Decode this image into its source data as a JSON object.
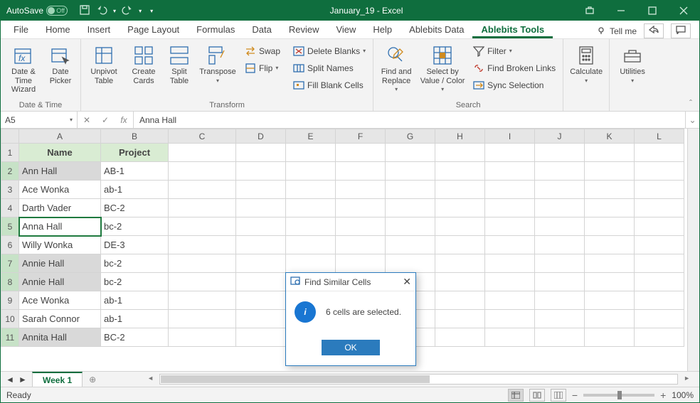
{
  "titlebar": {
    "autosave": "AutoSave",
    "autosave_state": "Off",
    "title": "January_19  -  Excel"
  },
  "tabs": {
    "items": [
      "File",
      "Home",
      "Insert",
      "Page Layout",
      "Formulas",
      "Data",
      "Review",
      "View",
      "Help",
      "Ablebits Data",
      "Ablebits Tools"
    ],
    "tellme": "Tell me"
  },
  "ribbon": {
    "datetime": {
      "label": "Date & Time",
      "date_time_wizard": "Date &\nTime Wizard",
      "date_picker": "Date\nPicker"
    },
    "transform": {
      "label": "Transform",
      "unpivot": "Unpivot\nTable",
      "create_cards": "Create\nCards",
      "split_table": "Split\nTable",
      "transpose": "Transpose",
      "swap": "Swap",
      "flip": "Flip",
      "delete_blanks": "Delete Blanks",
      "split_names": "Split Names",
      "fill_blank": "Fill Blank Cells"
    },
    "search": {
      "label": "Search",
      "find_replace": "Find and\nReplace",
      "select_by": "Select by\nValue / Color",
      "filter": "Filter",
      "broken": "Find Broken Links",
      "sync": "Sync Selection"
    },
    "calculate": {
      "label": "",
      "btn": "Calculate"
    },
    "utilities": {
      "label": "",
      "btn": "Utilities"
    }
  },
  "formula_bar": {
    "name": "A5",
    "value": "Anna Hall"
  },
  "grid": {
    "columns": [
      "A",
      "B",
      "C",
      "D",
      "E",
      "F",
      "G",
      "H",
      "I",
      "J",
      "K",
      "L"
    ],
    "headers": {
      "A": "Name",
      "B": "Project"
    },
    "rows": [
      {
        "n": 2,
        "A": "Ann Hall",
        "B": "AB-1",
        "sel": true
      },
      {
        "n": 3,
        "A": "Ace Wonka",
        "B": "ab-1"
      },
      {
        "n": 4,
        "A": "Darth Vader",
        "B": "BC-2"
      },
      {
        "n": 5,
        "A": "Anna Hall",
        "B": "bc-2",
        "active": true,
        "sel": true
      },
      {
        "n": 6,
        "A": "Willy Wonka",
        "B": "DE-3"
      },
      {
        "n": 7,
        "A": "Annie Hall",
        "B": "bc-2",
        "sel": true
      },
      {
        "n": 8,
        "A": "Annie Hall",
        "B": "bc-2",
        "sel": true
      },
      {
        "n": 9,
        "A": "Ace Wonka",
        "B": "ab-1"
      },
      {
        "n": 10,
        "A": "Sarah Connor",
        "B": "ab-1"
      },
      {
        "n": 11,
        "A": "Annita Hall",
        "B": "BC-2",
        "sel": true
      }
    ]
  },
  "sheets": {
    "active": "Week 1"
  },
  "status": {
    "ready": "Ready",
    "zoom": "100%"
  },
  "dialog": {
    "title": "Find Similar Cells",
    "message": "6 cells are selected.",
    "ok": "OK"
  }
}
